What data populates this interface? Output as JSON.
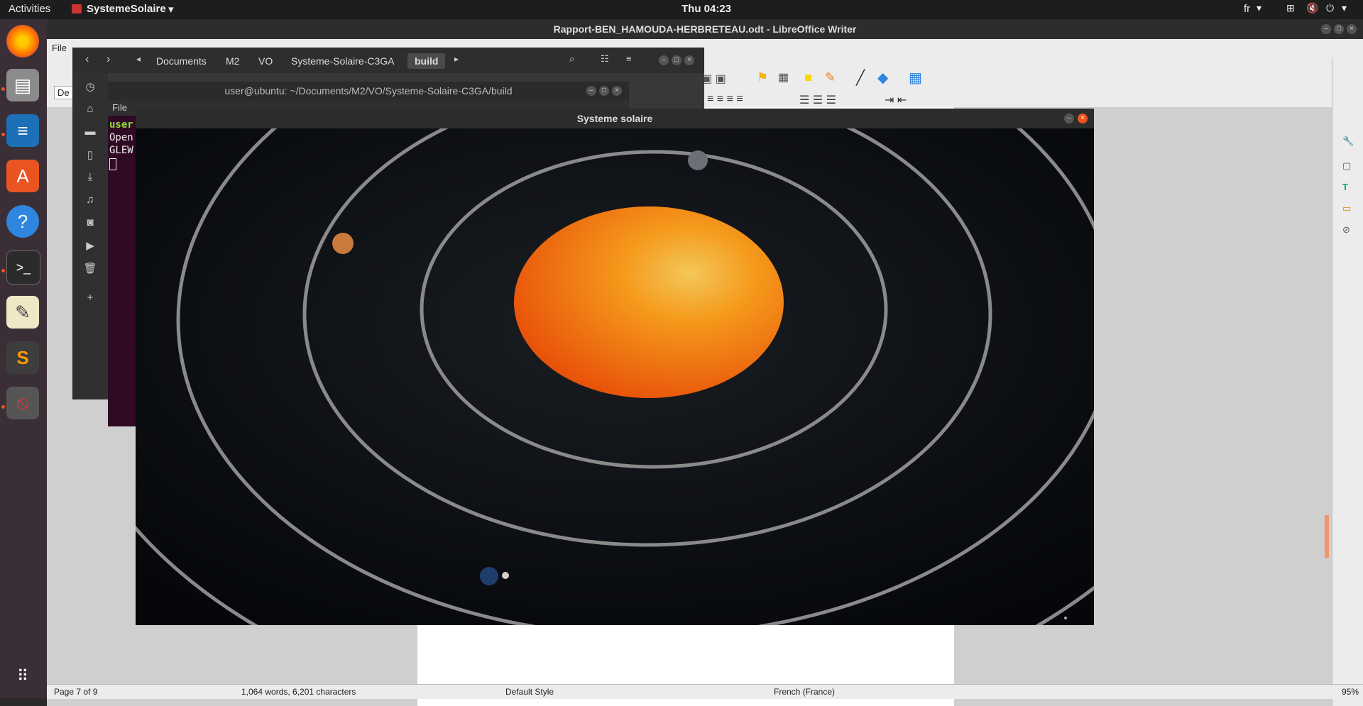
{
  "topbar": {
    "activities": "Activities",
    "app_name": "SystemeSolaire",
    "clock": "Thu 04:23",
    "lang": "fr"
  },
  "dock": {
    "items": [
      "firefox-icon",
      "files-icon",
      "writer-icon",
      "software-icon",
      "help-icon",
      "terminal-icon",
      "text-editor-icon",
      "sublime-icon",
      "systemesolaire-icon"
    ],
    "show_apps": "show-applications-icon"
  },
  "writer": {
    "title": "Rapport-BEN_HAMOUDA-HERBRETEAU.odt - LibreOffice Writer",
    "menu_file": "File",
    "style_box_partial": "De"
  },
  "statusbar": {
    "page": "Page 7 of 9",
    "words": "1,064 words, 6,201 characters",
    "style": "Default Style",
    "language": "French (France)",
    "zoom": "95%"
  },
  "files": {
    "crumbs": [
      "Documents",
      "M2",
      "VO",
      "Systeme-Solaire-C3GA",
      "build"
    ]
  },
  "terminal": {
    "title": "user@ubuntu: ~/Documents/M2/VO/Systeme-Solaire-C3GA/build",
    "menu_file": "File",
    "line1": "user",
    "line2": "Open",
    "line3": "GLEW"
  },
  "solar": {
    "title": "Systeme solaire"
  },
  "colors": {
    "ubuntu_orange": "#e95420",
    "sun": "#f57c0a",
    "orbit": "#8a8a8a"
  }
}
